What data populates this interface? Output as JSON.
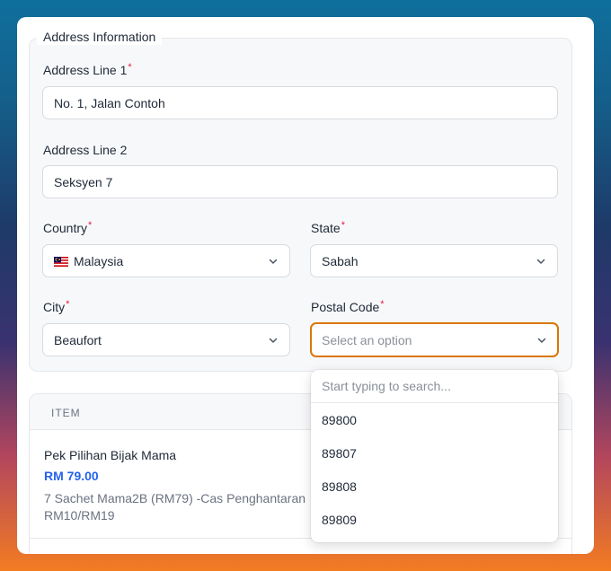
{
  "form": {
    "legend": "Address Information",
    "required_mark": "*",
    "address1": {
      "label": "Address Line 1",
      "value": "No. 1, Jalan Contoh"
    },
    "address2": {
      "label": "Address Line 2",
      "value": "Seksyen 7"
    },
    "country": {
      "label": "Country",
      "value": "Malaysia",
      "flag": "malaysia-flag-icon"
    },
    "state": {
      "label": "State",
      "value": "Sabah"
    },
    "city": {
      "label": "City",
      "value": "Beaufort"
    },
    "postal": {
      "label": "Postal Code",
      "placeholder": "Select an option"
    }
  },
  "dropdown": {
    "search_placeholder": "Start typing to search...",
    "options": [
      "89800",
      "89807",
      "89808",
      "89809"
    ]
  },
  "table": {
    "header": "ITEM",
    "rows": [
      {
        "name": "Pek Pilihan Bijak Mama",
        "price": "RM 79.00",
        "desc": "7 Sachet Mama2B (RM79) -Cas Penghantaran RM10/RM19"
      }
    ]
  },
  "colors": {
    "focus_border": "#d97706",
    "required": "#e11d48",
    "price": "#2563eb"
  }
}
